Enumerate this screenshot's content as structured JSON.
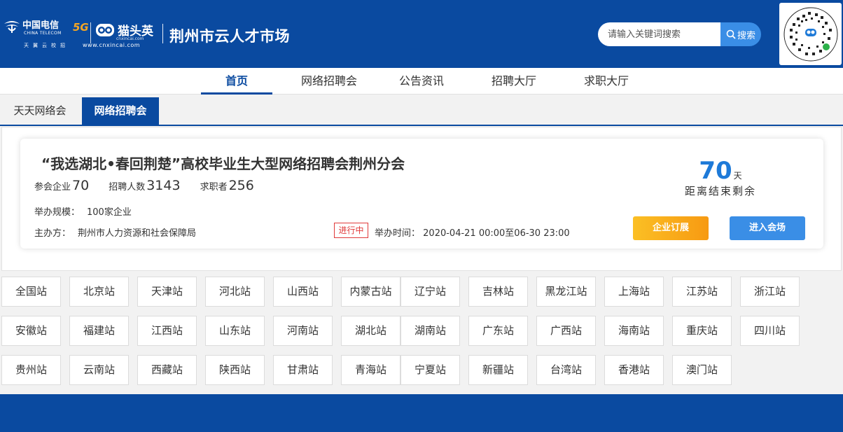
{
  "header": {
    "ct_brand_cn": "中国电信",
    "ct_brand_en": "CHINA TELECOM",
    "ct_5g": "5G",
    "ct_tagline": "天翼云校招",
    "mty_brand": "猫头英",
    "mty_url_small": "cnxincai.com",
    "mty_url": "www.cnxincai.com",
    "site_title": "荆州市云人才市场",
    "search_placeholder": "请输入关键词搜索",
    "search_button": "搜索",
    "qr_label": "猫头英"
  },
  "nav": {
    "items": [
      "首页",
      "网络招聘会",
      "公告资讯",
      "招聘大厅",
      "求职大厅"
    ],
    "active": "首页"
  },
  "subtabs": {
    "items": [
      "天天网络会",
      "网络招聘会"
    ],
    "active": "网络招聘会"
  },
  "event": {
    "title": "“我选湖北•春回荆楚”高校毕业生大型网络招聘会荆州分会",
    "companies_label": "参会企业",
    "companies": "70",
    "recruit_label": "招聘人数",
    "recruit": "3143",
    "seekers_label": "求职者",
    "seekers": "256",
    "scale_label": "举办规模：",
    "scale": "100家企业",
    "host_label": "主办方：",
    "host": "荆州市人力资源和社会保障局",
    "status": "进行中",
    "time_label": "举办时间：",
    "time": "2020-04-21 00:00至06-30 23:00",
    "days_left": "70",
    "days_unit": "天",
    "days_label": "距离结束剩余",
    "subscribe_button": "企业订展",
    "enter_button": "进入会场"
  },
  "stations": [
    "全国站",
    "北京站",
    "天津站",
    "河北站",
    "山西站",
    "内蒙古站",
    "辽宁站",
    "吉林站",
    "黑龙江站",
    "上海站",
    "江苏站",
    "浙江站",
    "安徽站",
    "福建站",
    "江西站",
    "山东站",
    "河南站",
    "湖北站",
    "湖南站",
    "广东站",
    "广西站",
    "海南站",
    "重庆站",
    "四川站",
    "贵州站",
    "云南站",
    "西藏站",
    "陕西站",
    "甘肃站",
    "青海站",
    "宁夏站",
    "新疆站",
    "台湾站",
    "香港站",
    "澳门站"
  ],
  "colors": {
    "brand_blue": "#0a4aa0",
    "accent_blue": "#1e7ad8",
    "button_blue": "#3a8ee6",
    "orange": "#f79a12",
    "status_red": "#e03a3a"
  }
}
